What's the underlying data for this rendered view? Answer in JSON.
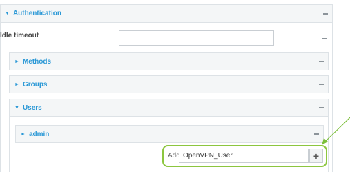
{
  "authentication": {
    "title": "Authentication",
    "idle_timeout_label": "Idle timeout",
    "idle_timeout_value": "",
    "sections": {
      "methods": "Methods",
      "groups": "Groups",
      "users": "Users"
    },
    "users": {
      "items": [
        "admin"
      ],
      "add_label": "Add",
      "add_value": "OpenVPN_User",
      "add_button_glyph": "+"
    }
  },
  "colors": {
    "link_blue": "#2a98d6",
    "highlight_green": "#8cc63f",
    "header_bg": "#f4f6f7",
    "border": "#dde2e6"
  },
  "icons": {
    "expanded": "triangle-down-icon",
    "collapsed": "triangle-right-icon",
    "remove": "dash-icon",
    "add": "plus-icon"
  }
}
